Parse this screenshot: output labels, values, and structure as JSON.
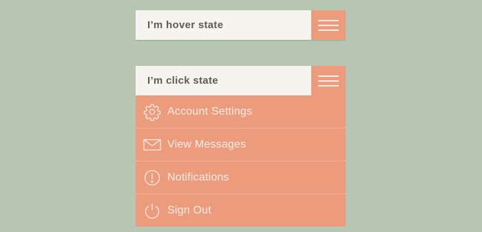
{
  "colors": {
    "background": "#b7c6b2",
    "accent": "#ec9b7c",
    "bar": "#f6f4ef",
    "label_text": "#5f5a55",
    "menu_text": "#fbefe9"
  },
  "hover_widget": {
    "label": "I’m hover state",
    "menu_icon": "hamburger-icon"
  },
  "click_widget": {
    "label": "I’m click state",
    "menu_icon": "hamburger-icon",
    "items": [
      {
        "label": "Account Settings",
        "icon": "gear-icon"
      },
      {
        "label": "View Messages",
        "icon": "envelope-icon"
      },
      {
        "label": "Notifications",
        "icon": "alert-icon"
      },
      {
        "label": "Sign Out",
        "icon": "power-icon"
      }
    ]
  }
}
